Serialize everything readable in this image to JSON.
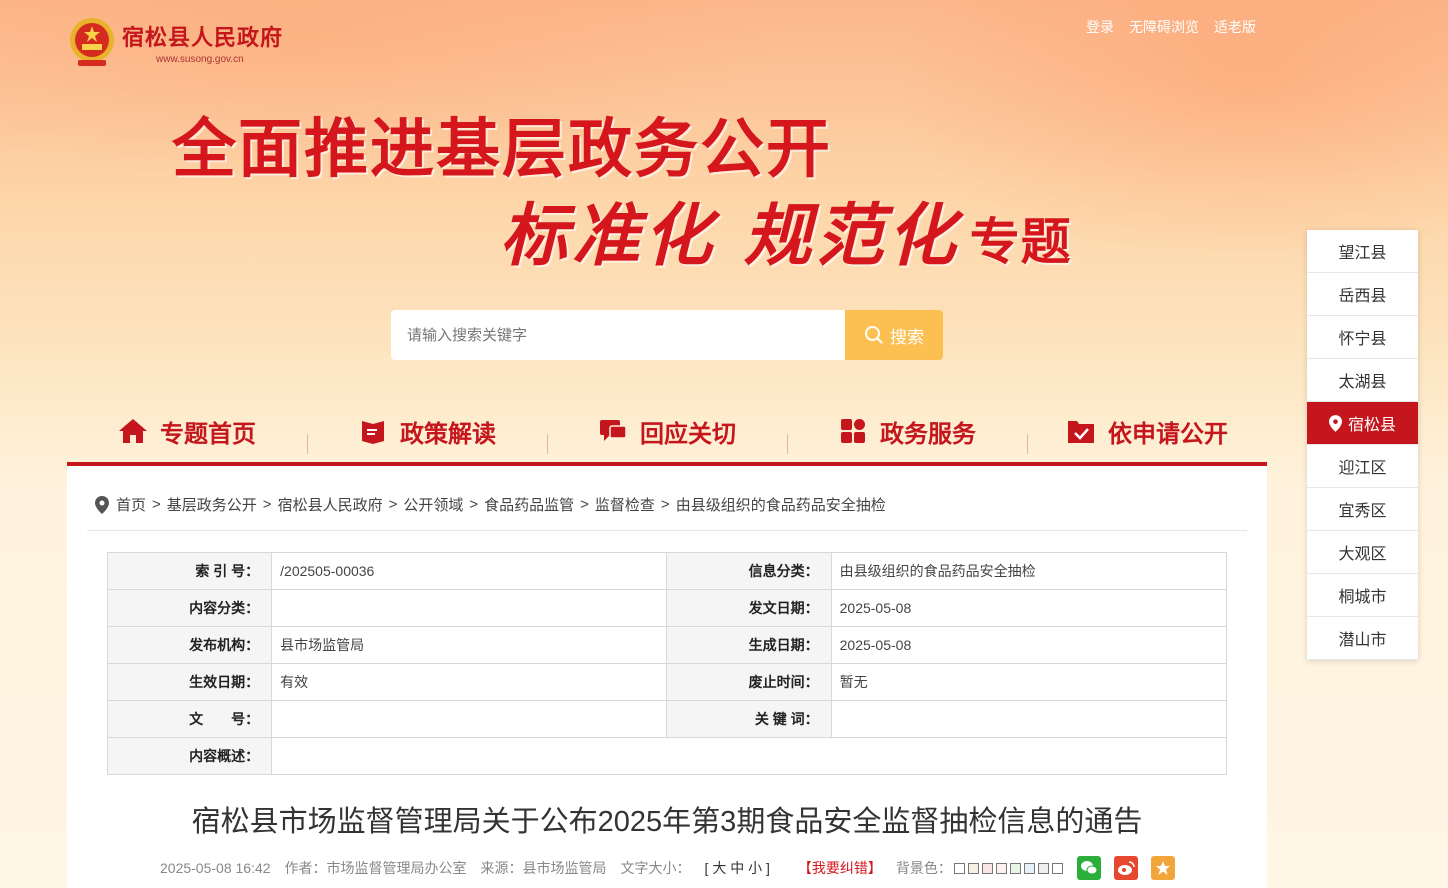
{
  "header": {
    "site_name": "宿松县人民政府",
    "site_url": "www.susong.gov.cn",
    "links": [
      "登录",
      "无障碍浏览",
      "适老版"
    ]
  },
  "banner": {
    "line1": "全面推进基层政务公开",
    "line2": "标准化 规范化",
    "line2_suffix": "专题"
  },
  "search": {
    "placeholder": "请输入搜索关键字",
    "button_label": "搜索"
  },
  "nav": [
    {
      "label": "专题首页",
      "icon": "home-icon"
    },
    {
      "label": "政策解读",
      "icon": "book-icon"
    },
    {
      "label": "回应关切",
      "icon": "chat-icon"
    },
    {
      "label": "政务服务",
      "icon": "grid-icon"
    },
    {
      "label": "依申请公开",
      "icon": "folder-check-icon"
    }
  ],
  "breadcrumb": [
    "首页",
    "基层政务公开",
    "宿松县人民政府",
    "公开领域",
    "食品药品监管",
    "监督检查",
    "由县级组织的食品药品安全抽检"
  ],
  "meta_table": {
    "index_label": "索 引 号：",
    "index_value": "/202505-00036",
    "category_label": "信息分类：",
    "category_value": "由县级组织的食品药品安全抽检",
    "content_type_label": "内容分类：",
    "content_type_value": "",
    "pub_date_label": "发文日期：",
    "pub_date_value": "2025-05-08",
    "org_label": "发布机构：",
    "org_value": "县市场监管局",
    "gen_date_label": "生成日期：",
    "gen_date_value": "2025-05-08",
    "effective_label": "生效日期：",
    "effective_value": "有效",
    "expire_label": "废止时间：",
    "expire_value": "暂无",
    "doc_no_label": "文　　号：",
    "doc_no_value": "",
    "keywords_label": "关 键 词：",
    "keywords_value": "",
    "summary_label": "内容概述：",
    "summary_value": ""
  },
  "document": {
    "title": "宿松县市场监督管理局关于公布2025年第3期食品安全监督抽检信息的通告",
    "datetime": "2025-05-08 16:42",
    "author": "作者：市场监督管理局办公室",
    "source": "来源：县市场监管局",
    "font_size_label": "文字大小：",
    "font_size_options": "[ 大 中 小 ]",
    "error_report": "【我要纠错】",
    "bg_color_label": "背景色：",
    "swatch_colors": [
      "#ffffff",
      "#f7f0e0",
      "#fbe6e6",
      "#fdf0f0",
      "#e6f5e6",
      "#e6f0f8",
      "#eeeeee",
      "#ffffff"
    ]
  },
  "side_nav": {
    "items": [
      "望江县",
      "岳西县",
      "怀宁县",
      "太湖县",
      "宿松县",
      "迎江区",
      "宜秀区",
      "大观区",
      "桐城市",
      "潜山市"
    ],
    "active": "宿松县"
  }
}
